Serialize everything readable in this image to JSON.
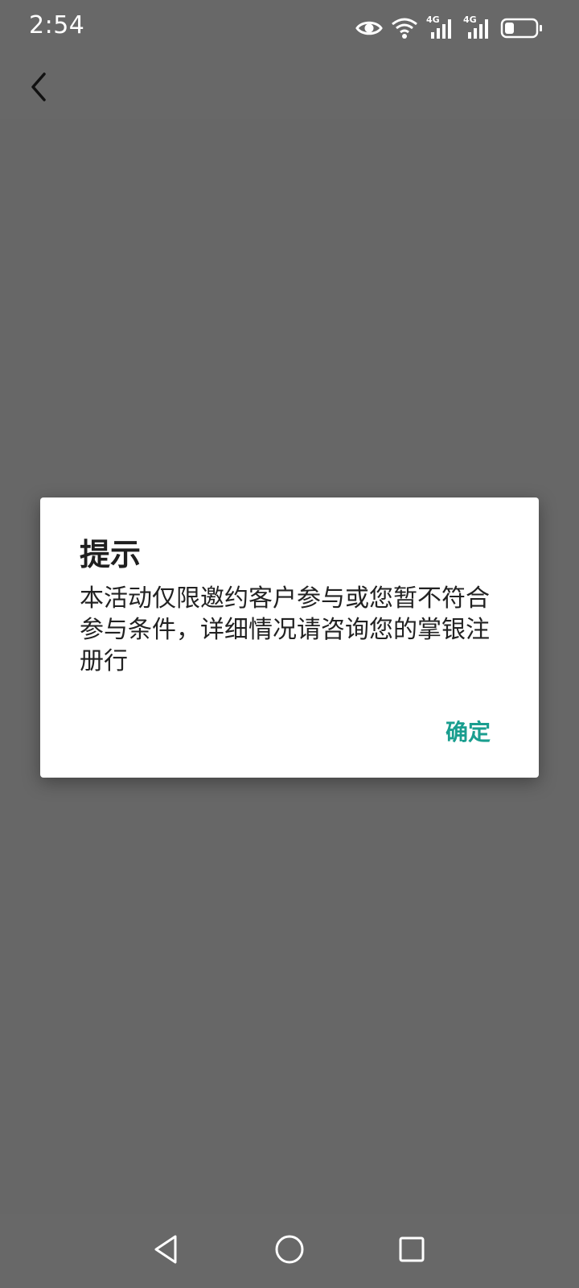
{
  "status_bar": {
    "time": "2:54",
    "icons": [
      "eye-icon",
      "wifi-icon",
      "signal-4g-icon",
      "signal-4g-icon",
      "battery-icon"
    ],
    "network_label_1": "4G",
    "network_label_2": "4G",
    "battery_level": 0.3
  },
  "top_bar": {
    "back_icon": "chevron-left-icon"
  },
  "dialog": {
    "title": "提示",
    "message": "本活动仅限邀约客户参与或您暂不符合参与条件，详细情况请咨询您的掌银注册行",
    "confirm_label": "确定",
    "accent_color": "#1a9e8f"
  },
  "nav_bar": {
    "icons": [
      "back-triangle-icon",
      "home-circle-icon",
      "recents-square-icon"
    ]
  },
  "colors": {
    "background": "#676767",
    "dialog_background": "#ffffff"
  }
}
